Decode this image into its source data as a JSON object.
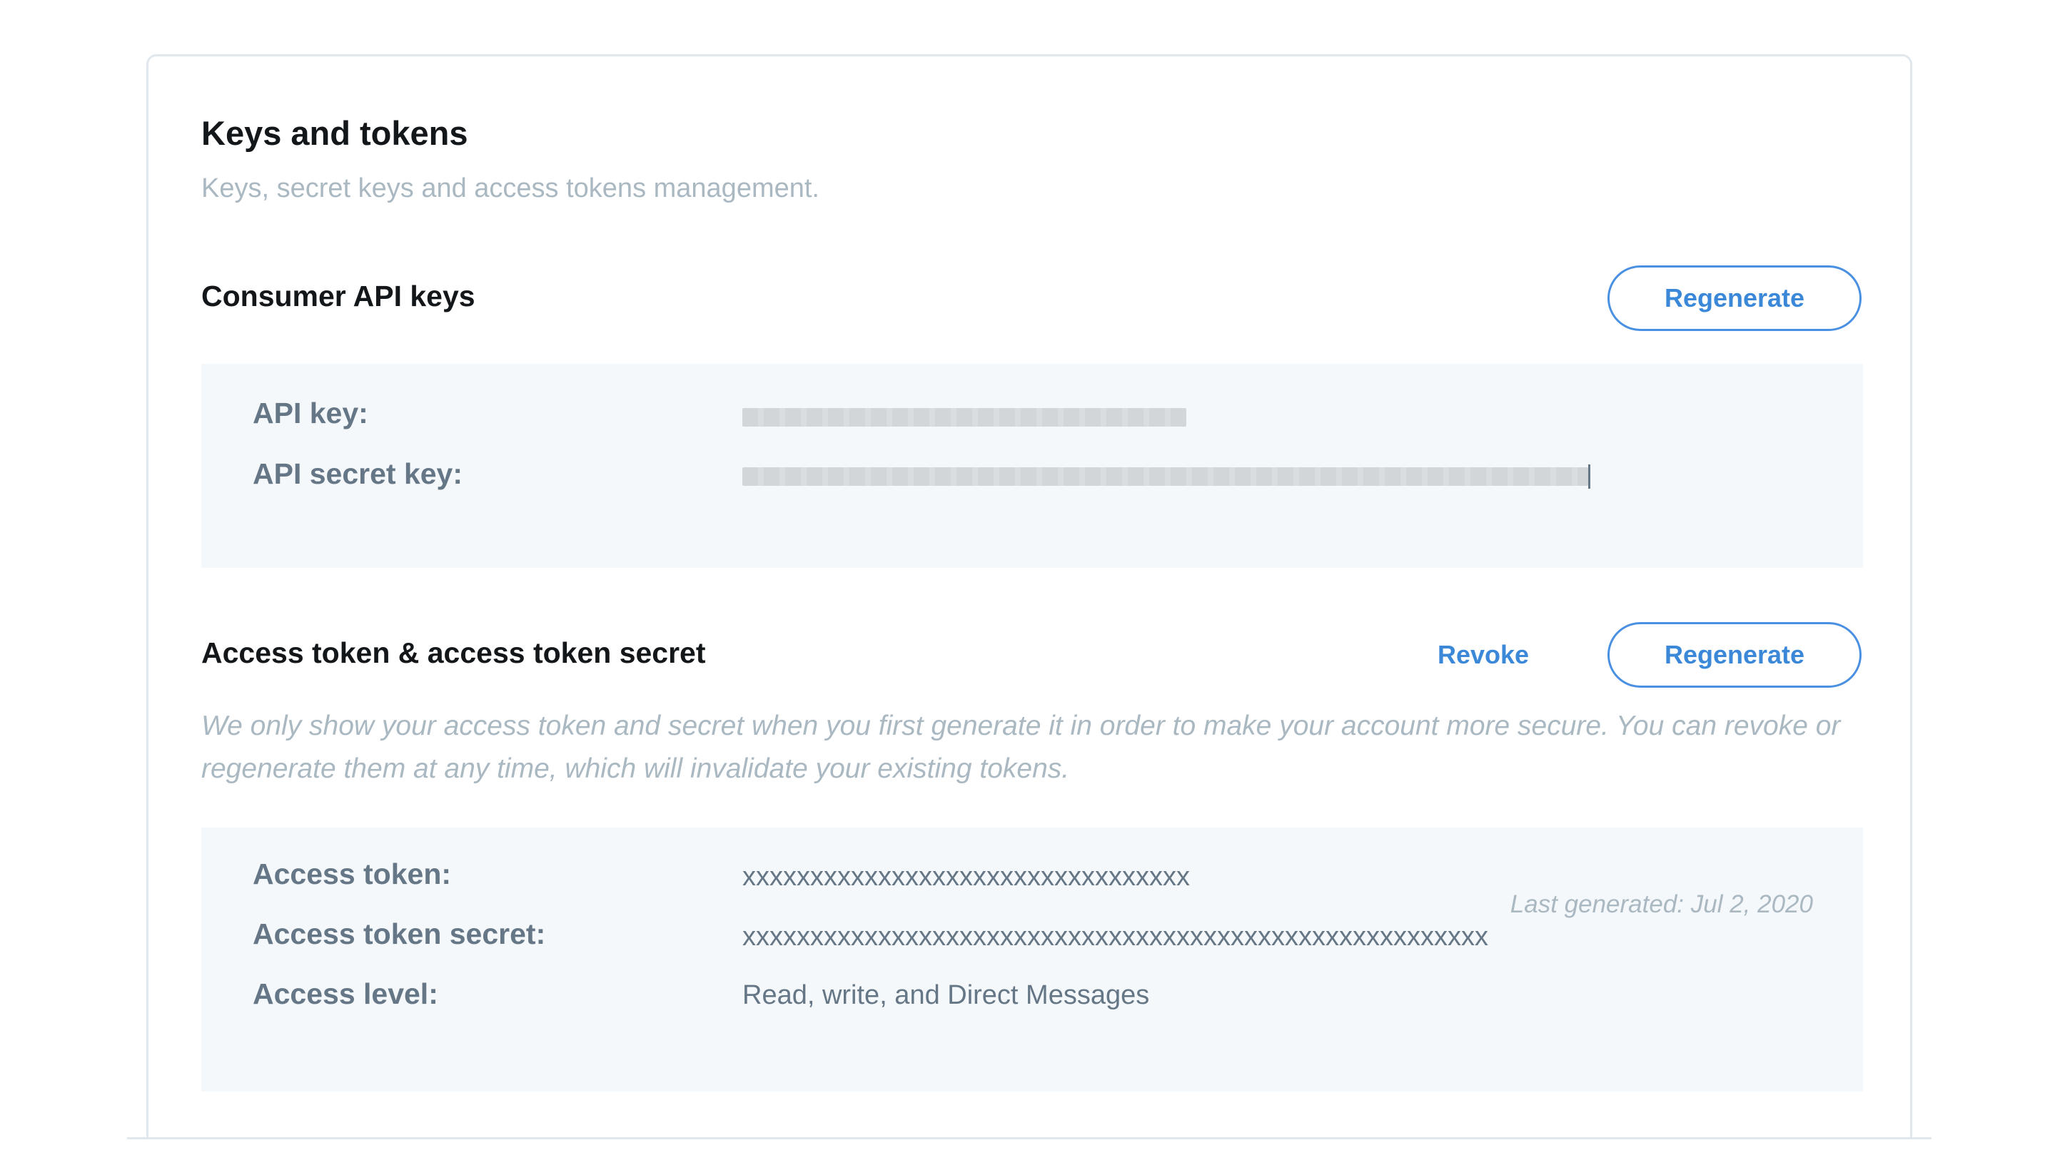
{
  "page": {
    "title": "Keys and tokens",
    "subtitle": "Keys, secret keys and access tokens management."
  },
  "consumer_keys": {
    "title": "Consumer API keys",
    "regenerate_label": "Regenerate",
    "rows": [
      {
        "label": "API key:",
        "value": "(redacted)"
      },
      {
        "label": "API secret key:",
        "value": "(redacted)"
      }
    ]
  },
  "access_token": {
    "title": "Access token & access token secret",
    "revoke_label": "Revoke",
    "regenerate_label": "Regenerate",
    "note": "We only show your access token and secret when you first generate it in order to make your account more secure. You can revoke or regenerate them at any time, which will invalidate your existing tokens.",
    "rows": [
      {
        "label": "Access token:",
        "value": "xxxxxxxxxxxxxxxxxxxxxxxxxxxxxxxxx"
      },
      {
        "label": "Access token secret:",
        "value": "xxxxxxxxxxxxxxxxxxxxxxxxxxxxxxxxxxxxxxxxxxxxxxxxxxxxxxx"
      },
      {
        "label": "Access level:",
        "value": "Read, write, and Direct Messages"
      }
    ],
    "last_generated": "Last generated: Jul 2, 2020"
  },
  "colors": {
    "accent": "#4a90e2",
    "panel_bg": "#f5f8fa",
    "muted_text": "#aab8c2",
    "label_text": "#657786"
  }
}
